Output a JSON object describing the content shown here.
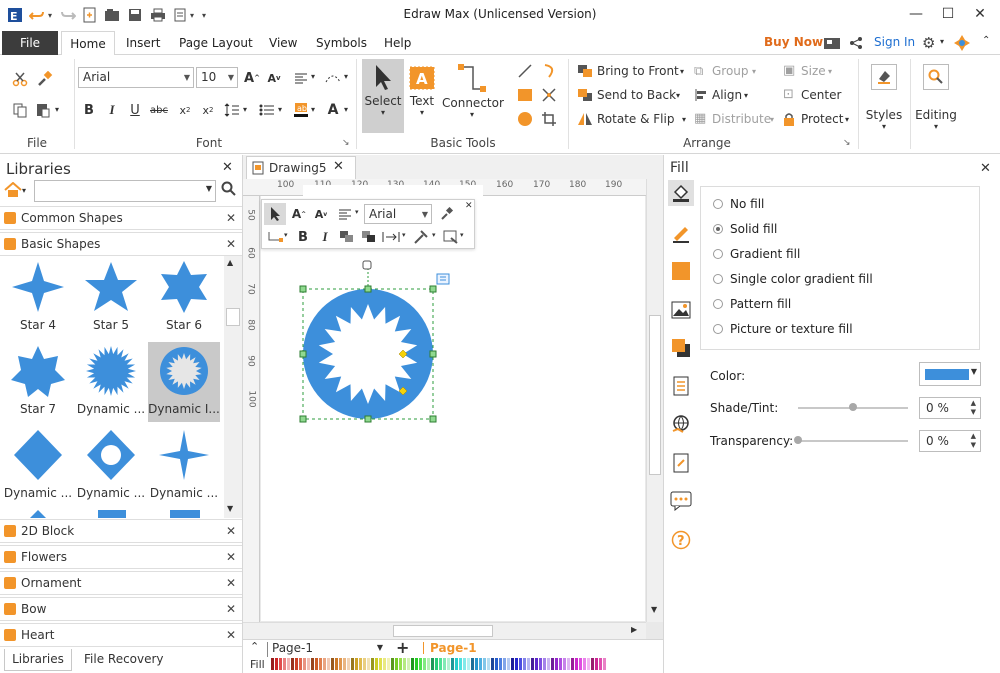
{
  "window": {
    "title": "Edraw Max (Unlicensed Version)",
    "minimize": "—",
    "maximize": "☐",
    "close": "✕"
  },
  "tabs": {
    "file": "File",
    "home": "Home",
    "insert": "Insert",
    "page_layout": "Page Layout",
    "view": "View",
    "symbols": "Symbols",
    "help": "Help",
    "buy_now": "Buy Now",
    "sign_in": "Sign In"
  },
  "ribbon": {
    "file_group_label": "File",
    "font_group_label": "Font",
    "font_name": "Arial",
    "font_size": "10",
    "basic_tools_label": "Basic Tools",
    "select_label": "Select",
    "text_label": "Text",
    "connector_label": "Connector",
    "arrange_label": "Arrange",
    "bring_to_front": "Bring to Front",
    "send_to_back": "Send to Back",
    "rotate_flip": "Rotate & Flip",
    "group": "Group",
    "align": "Align",
    "distribute": "Distribute",
    "size": "Size",
    "center": "Center",
    "protect": "Protect",
    "styles": "Styles",
    "editing": "Editing"
  },
  "libraries": {
    "title": "Libraries",
    "search_value": "",
    "common_shapes": "Common Shapes",
    "basic_shapes": "Basic Shapes",
    "shapes": [
      {
        "label": "Star 4"
      },
      {
        "label": "Star 5"
      },
      {
        "label": "Star 6"
      },
      {
        "label": "Star 7"
      },
      {
        "label": "Dynamic ..."
      },
      {
        "label": "Dynamic I..."
      },
      {
        "label": "Dynamic ..."
      },
      {
        "label": "Dynamic ..."
      },
      {
        "label": "Dynamic ..."
      }
    ],
    "more_libraries": [
      {
        "label": "2D Block"
      },
      {
        "label": "Flowers"
      },
      {
        "label": "Ornament"
      },
      {
        "label": "Bow"
      },
      {
        "label": "Heart"
      }
    ],
    "bottom_tab_libraries": "Libraries",
    "bottom_tab_recovery": "File Recovery"
  },
  "document": {
    "tab_name": "Drawing5",
    "ruler_h": [
      "100",
      "110",
      "120",
      "130",
      "140",
      "150",
      "160",
      "170",
      "180",
      "190"
    ],
    "ruler_v": [
      "50",
      "60",
      "70",
      "80",
      "90",
      "100"
    ],
    "mini_font": "Arial",
    "page_select": "Page-1",
    "page_tab": "Page-1",
    "fill_label": "Fill"
  },
  "fill_panel": {
    "title": "Fill",
    "options": [
      {
        "label": "No fill",
        "selected": false
      },
      {
        "label": "Solid fill",
        "selected": true
      },
      {
        "label": "Gradient fill",
        "selected": false
      },
      {
        "label": "Single color gradient fill",
        "selected": false
      },
      {
        "label": "Pattern fill",
        "selected": false
      },
      {
        "label": "Picture or texture fill",
        "selected": false
      }
    ],
    "color_label": "Color:",
    "color_value": "#3d8fdb",
    "shade_label": "Shade/Tint:",
    "shade_value": "0 %",
    "shade_level": 0.5,
    "transparency_label": "Transparency:",
    "transparency_value": "0 %",
    "transparency_level": 0
  },
  "colors": {
    "accent_orange": "#f2952a",
    "shape_blue": "#3d8fdb",
    "buy_now": "#e06b1b",
    "sign_in": "#1f6fd1"
  }
}
